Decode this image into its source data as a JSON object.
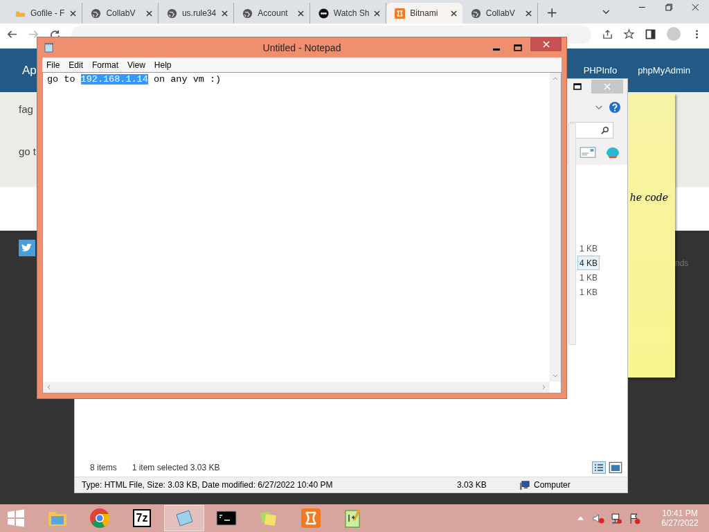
{
  "browser": {
    "tabs": [
      {
        "label": "Gofile - F",
        "kind": "folder",
        "selected": false
      },
      {
        "label": "CollabV",
        "kind": "globe",
        "selected": false
      },
      {
        "label": "us.rule34",
        "kind": "globe",
        "selected": false
      },
      {
        "label": "Account",
        "kind": "globe",
        "selected": false
      },
      {
        "label": "Watch Sh",
        "kind": "news",
        "selected": false
      },
      {
        "label": "Bitnami",
        "kind": "xampp",
        "selected": true
      },
      {
        "label": "CollabV",
        "kind": "globe",
        "selected": false
      }
    ],
    "site": {
      "brand": "Ap",
      "links": [
        "PHPInfo",
        "phpMyAdmin"
      ],
      "lines": [
        "fag",
        "go t"
      ],
      "footer_text": "nds"
    }
  },
  "sticky_note": {
    "text": "he code"
  },
  "explorer": {
    "sizes": [
      {
        "text": "1 KB",
        "selected": false
      },
      {
        "text": "4 KB",
        "selected": true
      },
      {
        "text": "1 KB",
        "selected": false
      },
      {
        "text": "1 KB",
        "selected": false
      }
    ],
    "status": {
      "count": "8 items",
      "selection": "1 item selected  3.03 KB"
    },
    "details": {
      "info": "Type: HTML File, Size: 3.03 KB, Date modified: 6/27/2022 10:40 PM",
      "size": "3.03 KB",
      "zone": "Computer"
    }
  },
  "notepad": {
    "title": "Untitled - Notepad",
    "menu": [
      "File",
      "Edit",
      "Format",
      "View",
      "Help"
    ],
    "text_before": "go to ",
    "text_selected": "192.168.1.14",
    "text_after": " on any vm :)"
  },
  "taskbar": {
    "apps": [
      {
        "kind": "explorer",
        "selected": false
      },
      {
        "kind": "chrome",
        "selected": false
      },
      {
        "kind": "archiver",
        "label": "7z",
        "selected": false
      },
      {
        "kind": "notepad",
        "selected": true
      },
      {
        "kind": "console",
        "selected": false
      },
      {
        "kind": "sticky",
        "selected": false
      },
      {
        "kind": "xampp",
        "selected": false
      },
      {
        "kind": "editor",
        "selected": false
      }
    ],
    "time": "10:41 PM",
    "date": "6/27/2022"
  }
}
